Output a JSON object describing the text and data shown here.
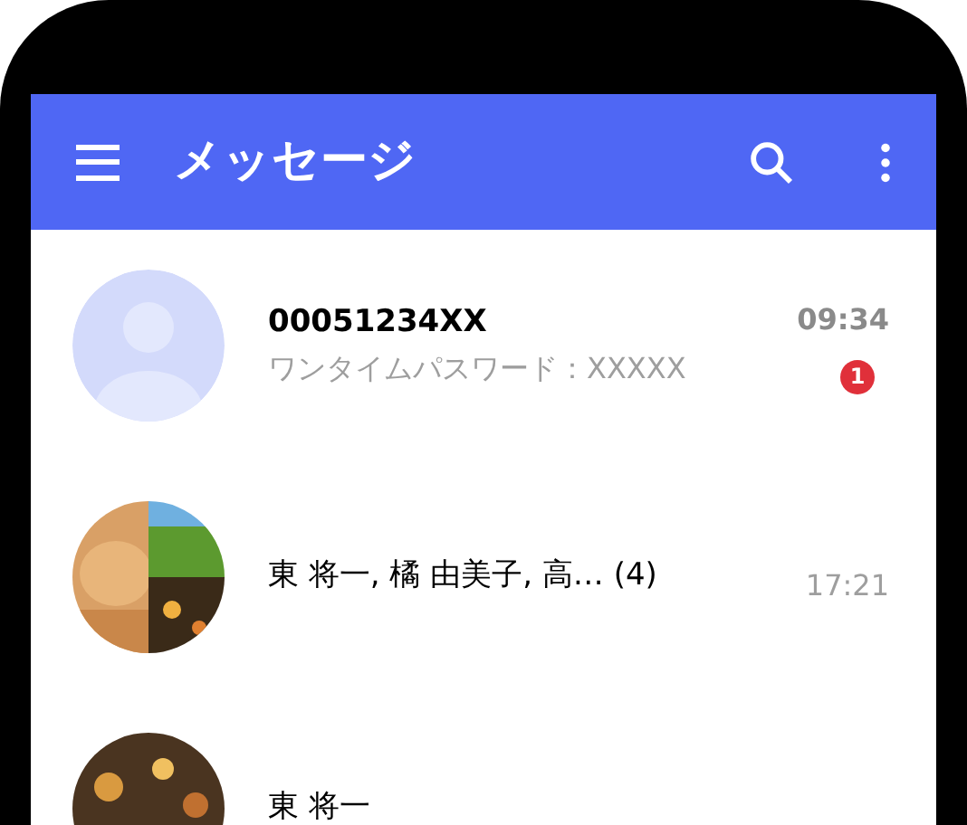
{
  "app_bar": {
    "title": "メッセージ"
  },
  "conversations": [
    {
      "avatar": {
        "kind": "default"
      },
      "name": "00051234XX",
      "preview": "ワンタイムパスワード：XXXXX",
      "time": "09:34",
      "unread": true,
      "badge": "1"
    },
    {
      "name": "東 将一, 橘 由美子, 高… (4)",
      "time": "17:21",
      "unread": false
    },
    {
      "name": "東 将一"
    }
  ]
}
